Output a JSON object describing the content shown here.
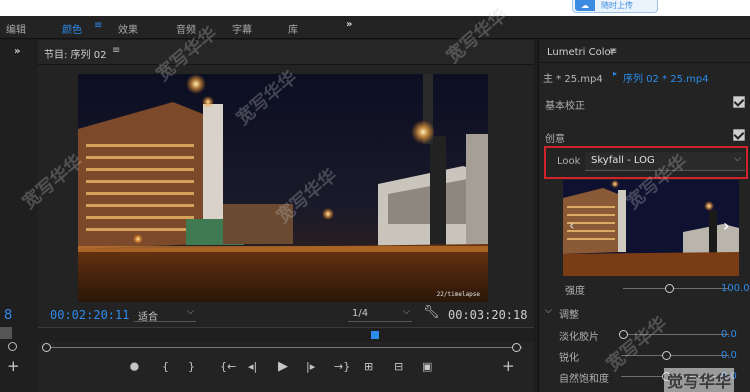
{
  "top_strip": {
    "button_label": "随时上传",
    "button_icon": "cloud-icon"
  },
  "workspace_tabs": [
    {
      "label": "编辑",
      "active": false
    },
    {
      "label": "颜色",
      "active": true
    },
    {
      "label": "效果",
      "active": false
    },
    {
      "label": "音频",
      "active": false
    },
    {
      "label": "字幕",
      "active": false
    },
    {
      "label": "库",
      "active": false
    }
  ],
  "workspace_more": "»",
  "workspace_menu_icon": "≡",
  "left_gutter": {
    "expand_glyph": "»",
    "number": "8",
    "add_glyph": "+"
  },
  "program_monitor": {
    "title": "节目: 序列 02",
    "menu_glyph": "≡",
    "current_time": "00:02:20:11",
    "fit_label": "适合",
    "resolution": "1/4",
    "duration": "00:03:20:18",
    "video_caption": "22/timelapse",
    "add_glyph": "+"
  },
  "lumetri": {
    "title": "Lumetri Color",
    "menu_glyph": "≡",
    "master_clip": "主 * 25.mp4",
    "sequence_clip": "序列 02 * 25.mp4",
    "basic_correction": "基本校正",
    "creative": "创意",
    "look_label": "Look",
    "look_value": "Skyfall - LOG",
    "intensity_label": "强度",
    "intensity_value": "100.0",
    "adjust_label": "调整",
    "faded_film_label": "淡化胶片",
    "faded_film_value": "0.0",
    "sharpen_label": "锐化",
    "sharpen_value": "0.0",
    "vibrance_label": "自然饱和度",
    "vibrance_value": "0.0"
  },
  "colors": {
    "accent": "#2d8ceb",
    "highlight_box": "#d0242a"
  },
  "watermark_text": "宽写华华",
  "footer_watermark": "觉写华华"
}
